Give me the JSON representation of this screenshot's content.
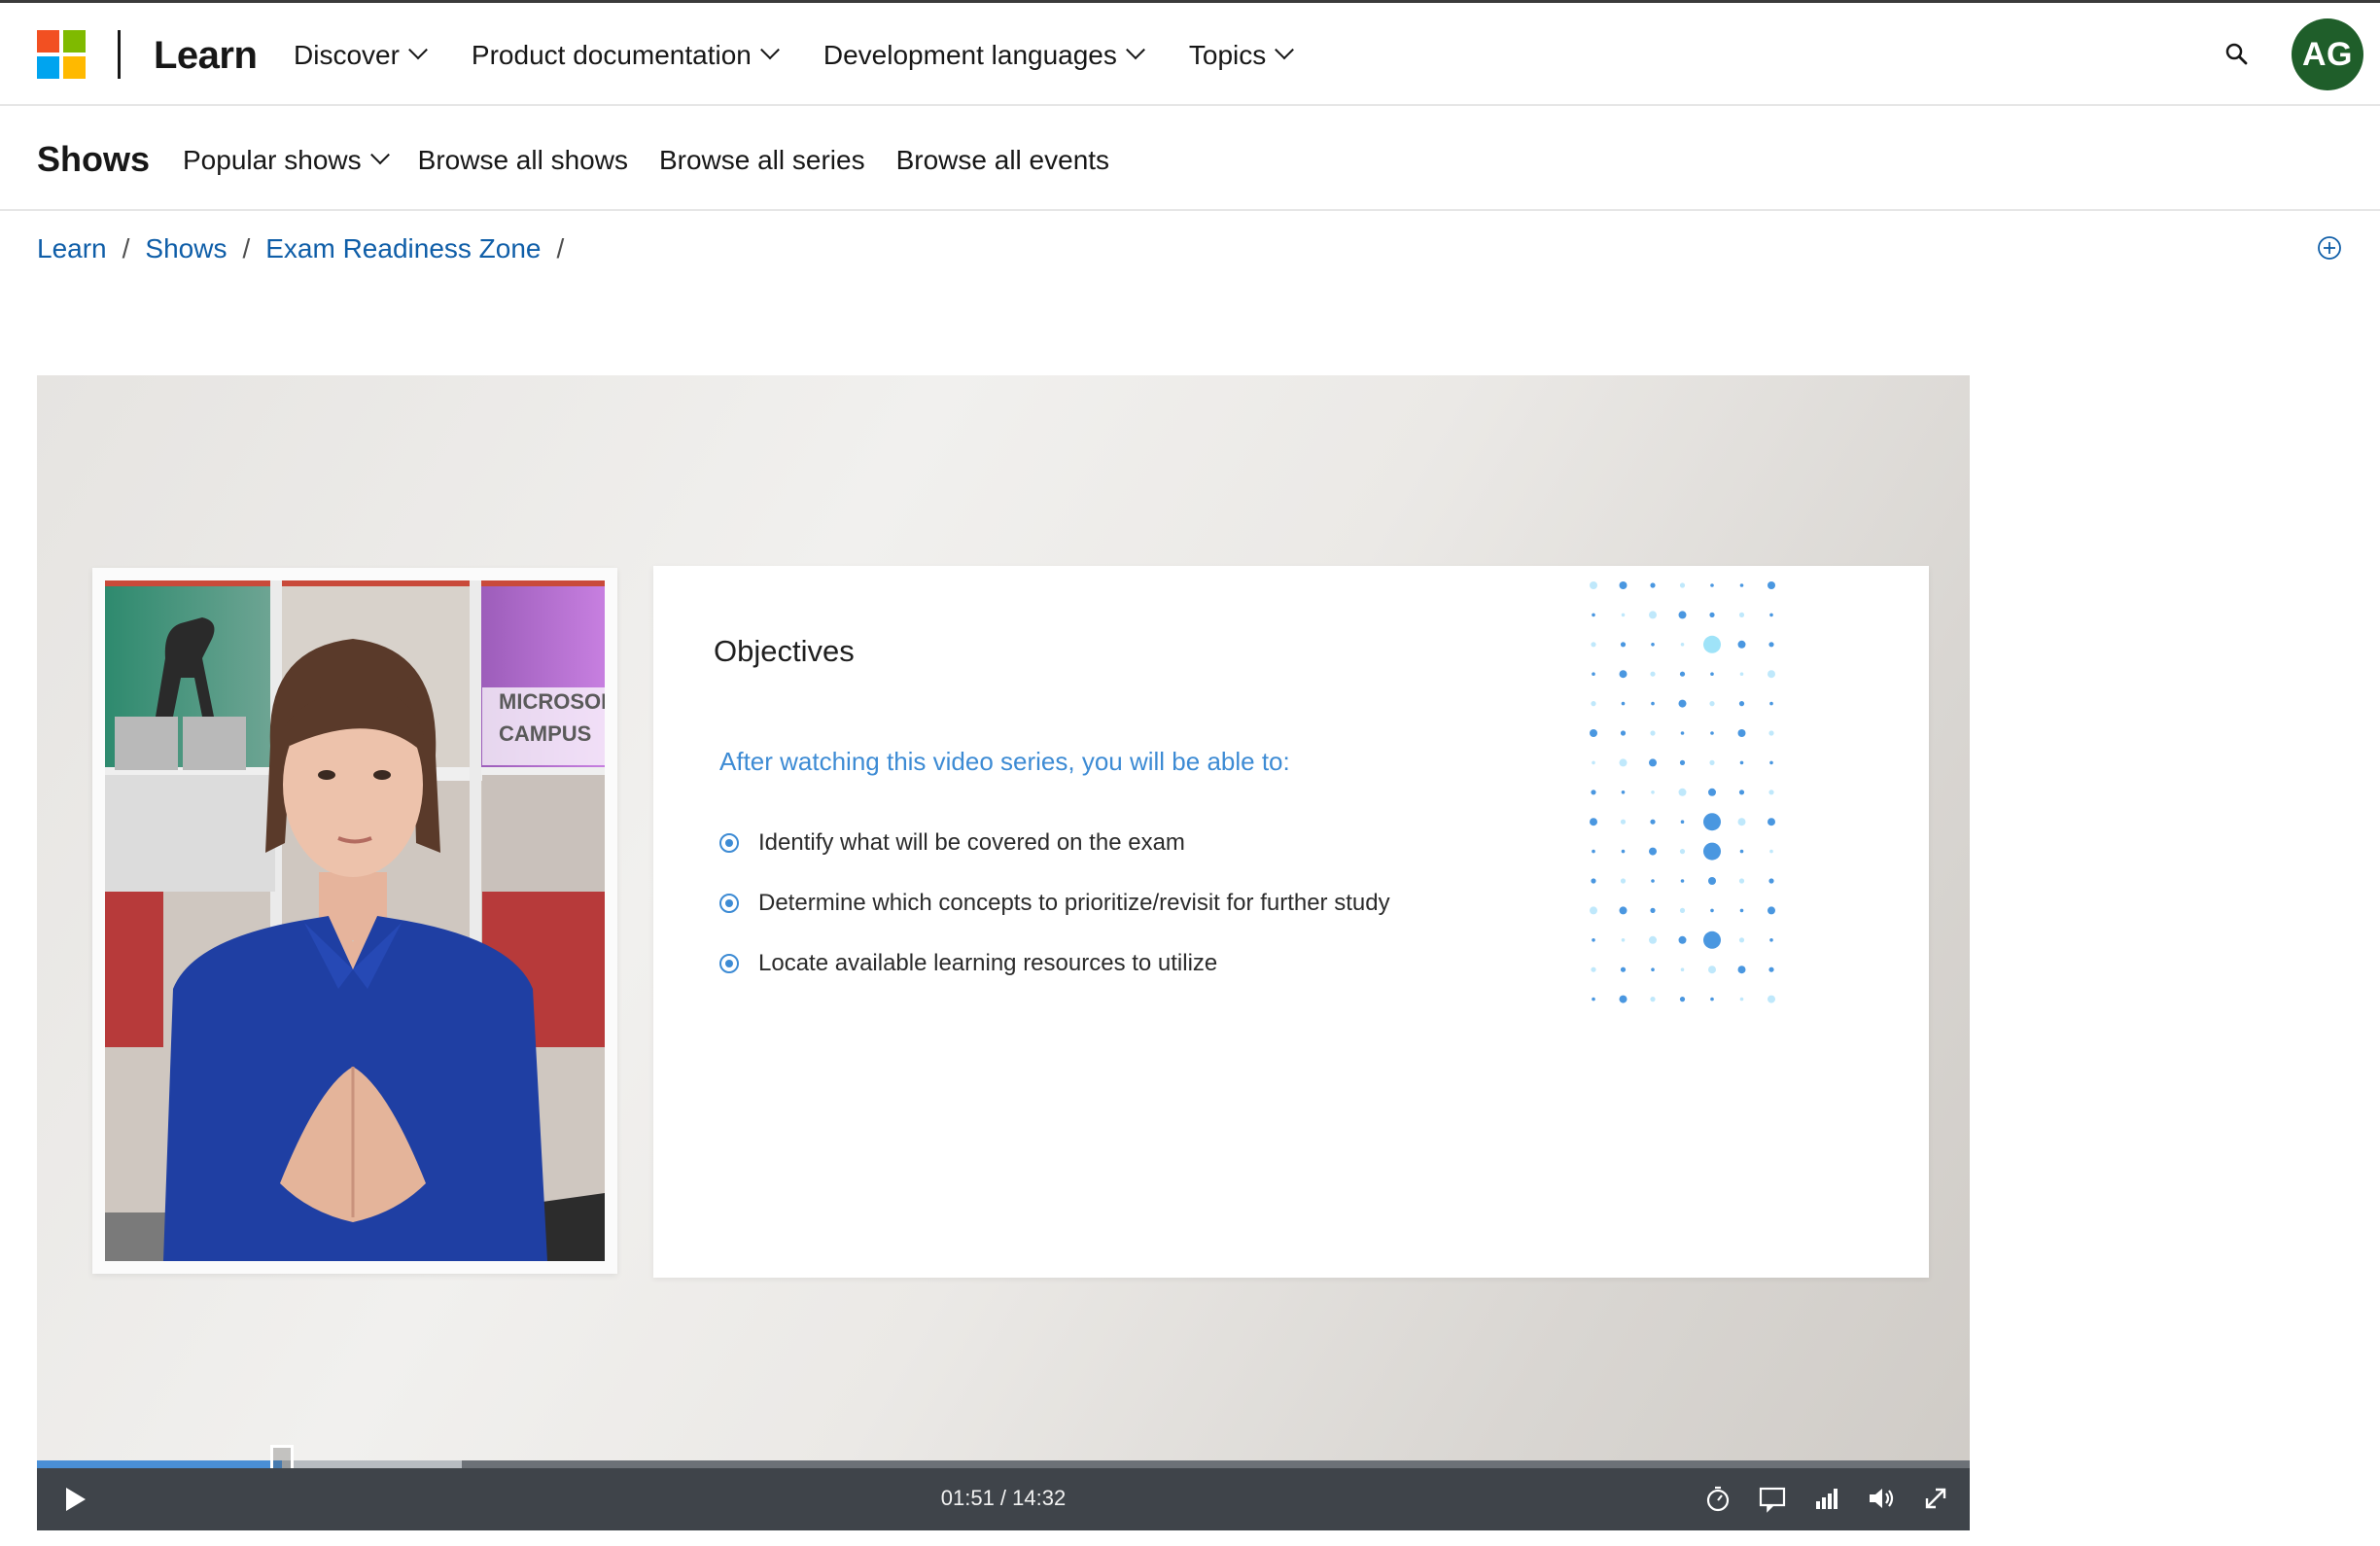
{
  "header": {
    "brand": "Learn",
    "nav": [
      {
        "label": "Discover"
      },
      {
        "label": "Product documentation"
      },
      {
        "label": "Development languages"
      },
      {
        "label": "Topics"
      }
    ],
    "avatar_initials": "AG"
  },
  "subheader": {
    "title": "Shows",
    "nav": [
      {
        "label": "Popular shows"
      },
      {
        "label": "Browse all shows"
      },
      {
        "label": "Browse all series"
      },
      {
        "label": "Browse all events"
      }
    ]
  },
  "breadcrumb": [
    "Learn",
    "Shows",
    "Exam Readiness Zone"
  ],
  "video": {
    "presenter_sign": [
      "MICROSOFT",
      "CAMPUS"
    ],
    "slide": {
      "title": "Objectives",
      "subtitle": "After watching this video series, you will be able to:",
      "bullets": [
        "Identify what will be covered on the exam",
        "Determine which concepts to prioritize/revisit for further study",
        "Locate available learning resources to utilize"
      ]
    },
    "player": {
      "time": "01:51 / 14:32",
      "played_fraction": 0.127,
      "buffered_fraction": 0.22
    }
  },
  "colors": {
    "link": "#0f5ea8",
    "avatar_bg": "#1f5e2a",
    "slide_accent": "#3d8bd4",
    "controls_bg": "#3f444a"
  }
}
